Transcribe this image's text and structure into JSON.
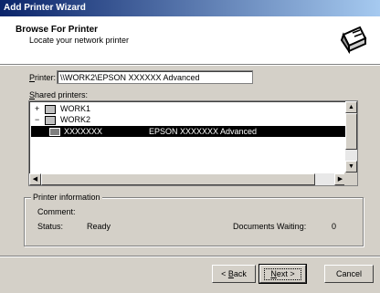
{
  "window": {
    "title": "Add Printer Wizard"
  },
  "header": {
    "title": "Browse For Printer",
    "subtitle": "Locate your network printer",
    "icon": "printer-icon"
  },
  "printer_field": {
    "label_mnemonic": "P",
    "label_rest": "rinter:",
    "value": "\\\\WORK2\\EPSON XXXXXX Advanced"
  },
  "shared_printers": {
    "label_mnemonic": "S",
    "label_rest": "hared printers:",
    "items": [
      {
        "name": "WORK1",
        "comment": "",
        "expander": "+"
      },
      {
        "name": "WORK2",
        "comment": "",
        "expander": "−"
      },
      {
        "name": "XXXXXXX",
        "comment": "EPSON XXXXXXX Advanced",
        "selected": true
      }
    ]
  },
  "printer_info": {
    "legend": "Printer information",
    "comment_label": "Comment:",
    "comment_value": "",
    "status_label": "Status:",
    "status_value": "Ready",
    "docs_label": "Documents Waiting:",
    "docs_value": "0"
  },
  "buttons": {
    "back": {
      "pre": "< ",
      "mnemonic": "B",
      "rest": "ack"
    },
    "next": {
      "mnemonic": "N",
      "rest": "ext >"
    },
    "cancel": "Cancel"
  }
}
